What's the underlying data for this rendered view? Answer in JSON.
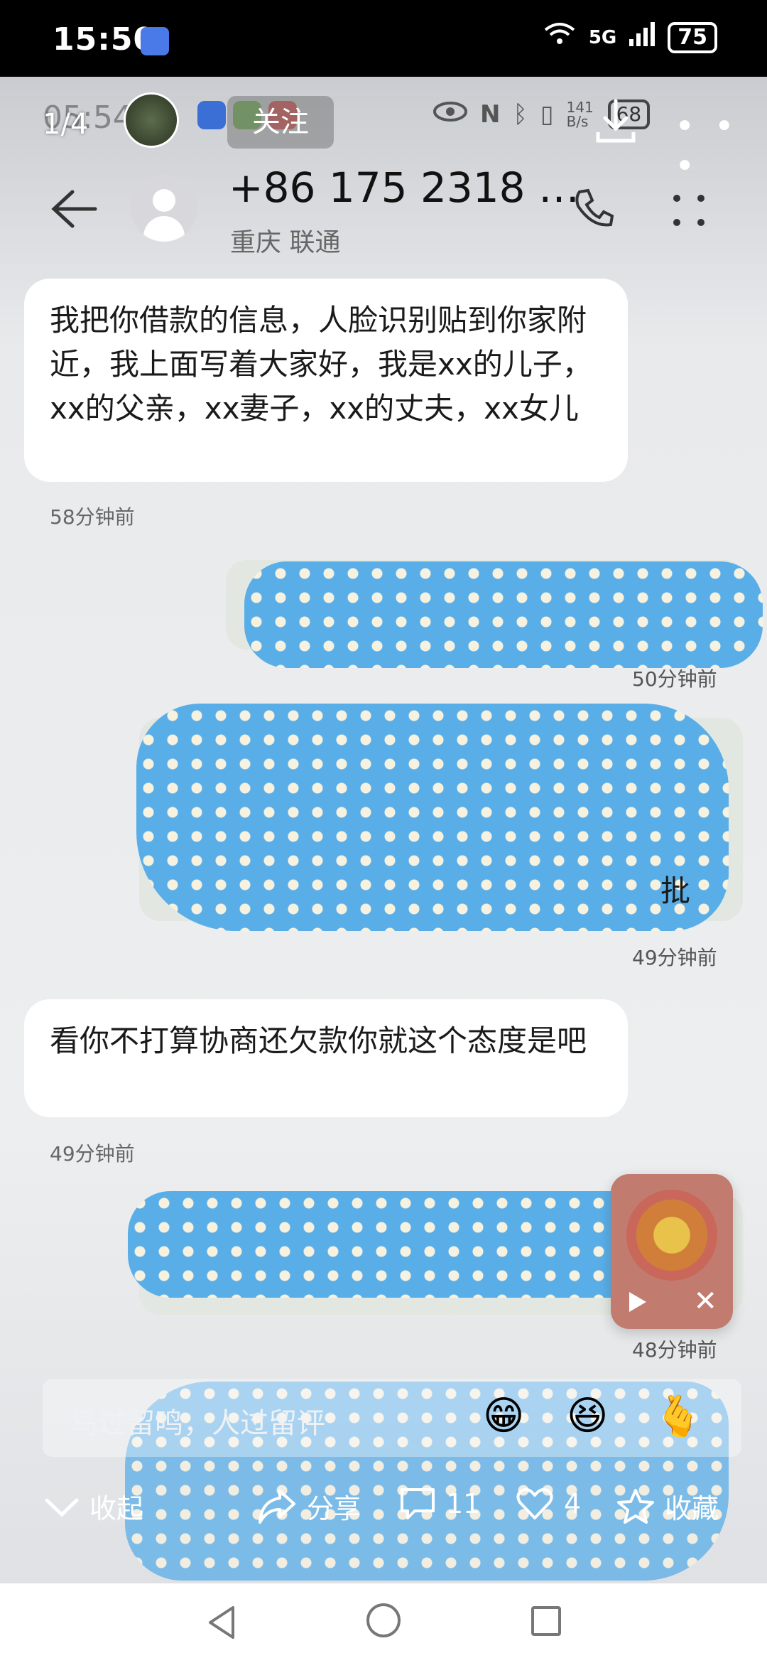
{
  "status_bar": {
    "time": "15:50",
    "network": "5G",
    "battery": "75"
  },
  "viewer": {
    "page_index": "1/4",
    "follow_label": "关注",
    "embedded_time": "05:54",
    "embedded_speed": "141 B/s",
    "embedded_battery": "68"
  },
  "chat_header": {
    "contact_number": "+86 175 2318 …",
    "contact_location": "重庆 联通"
  },
  "messages": [
    {
      "direction": "in",
      "text": "我把你借款的信息，人脸识别贴到你家附近，我上面写着大家好，我是xx的儿子，xx的父亲，xx妻子，xx的丈夫，xx女儿",
      "time": "58分钟前"
    },
    {
      "direction": "out",
      "text": "",
      "time": "50分钟前"
    },
    {
      "direction": "out",
      "text": "批",
      "time": "49分钟前"
    },
    {
      "direction": "in",
      "text": "看你不打算协商还欠款你就这个态度是吧",
      "time": "49分钟前"
    },
    {
      "direction": "out",
      "text": "",
      "time": "48分钟前"
    }
  ],
  "music_widget": {
    "play_icon": "play-icon",
    "close_label": "✕"
  },
  "comment_bar": {
    "placeholder": "鸟过留鸣，人过留评",
    "emojis": [
      "😁",
      "😆",
      "🫰"
    ]
  },
  "actions": {
    "collapse": "收起",
    "share": "分享",
    "comments": "11",
    "likes": "4",
    "favorite": "收藏"
  },
  "colors": {
    "censor_blue": "#5aaee8",
    "music_widget": "#c17b6f"
  }
}
